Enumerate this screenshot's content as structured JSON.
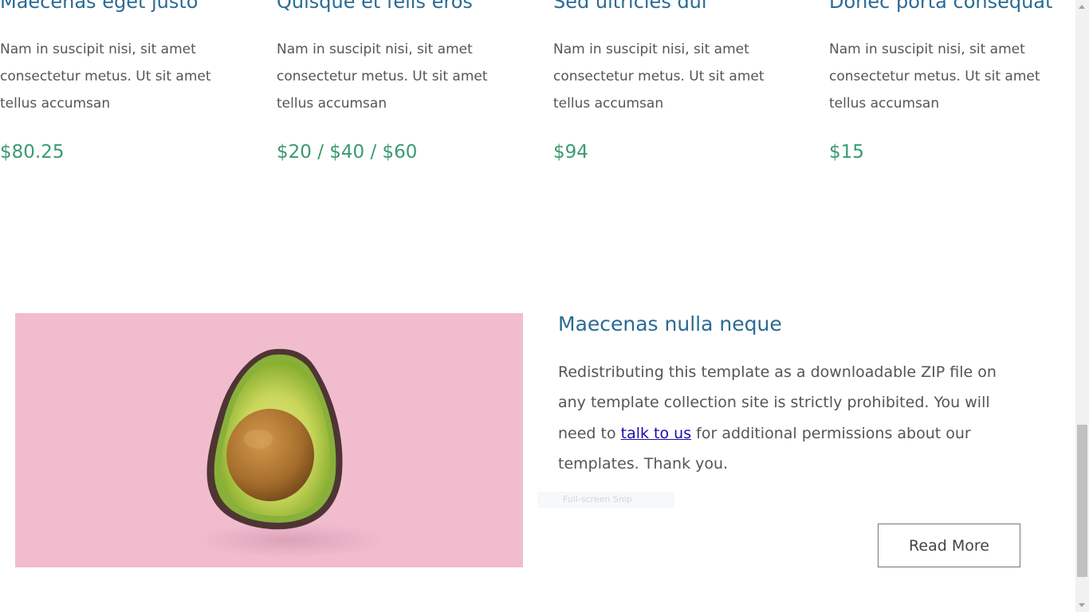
{
  "menu_items": [
    {
      "title": "Maecenas eget justo",
      "description": "Nam in suscipit nisi, sit amet consectetur metus. Ut sit amet tellus accumsan",
      "price": "$80.25"
    },
    {
      "title": "Quisque et felis eros",
      "description": "Nam in suscipit nisi, sit amet consectetur metus. Ut sit amet tellus accumsan",
      "price": "$20 / $40 / $60"
    },
    {
      "title": "Sed ultricies dui",
      "description": "Nam in suscipit nisi, sit amet consectetur metus. Ut sit amet tellus accumsan",
      "price": "$94"
    },
    {
      "title": "Donec porta consequat",
      "description": "Nam in suscipit nisi, sit amet consectetur metus. Ut sit amet tellus accumsan",
      "price": "$15"
    }
  ],
  "feature": {
    "title": "Maecenas nulla neque",
    "text_before_link": "Redistributing this template as a downloadable ZIP file on any template collection site is strictly prohibited. You will need to ",
    "link_text": "talk to us",
    "text_after_link": " for additional permissions about our templates. Thank you.",
    "button_label": "Read More",
    "image_icon": "avocado-image"
  },
  "overlay": {
    "snip_hint": "Full-screen Snip"
  },
  "colors": {
    "heading": "#2a6b94",
    "price": "#3a9b6e",
    "body_text": "#555555",
    "image_bg": "#f2bccf",
    "link": "#1a0dab"
  }
}
